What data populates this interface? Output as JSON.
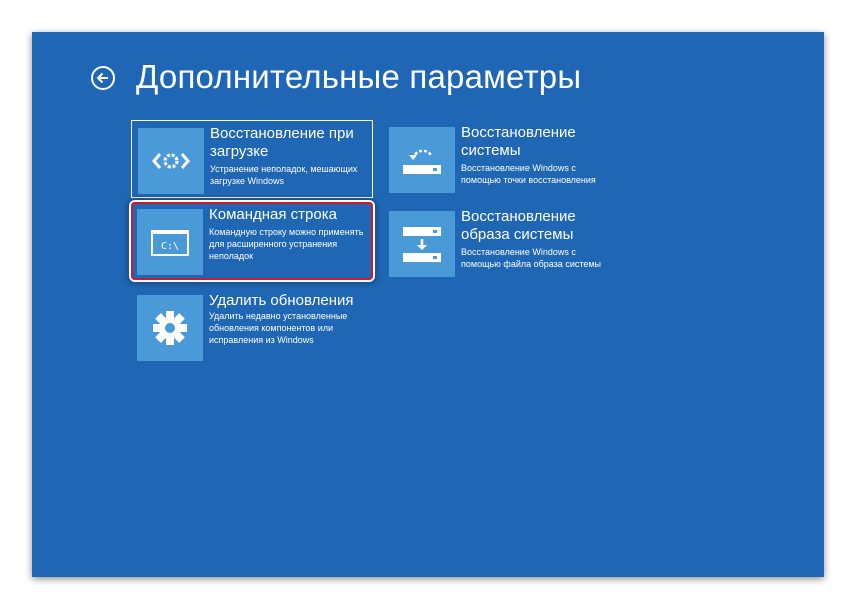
{
  "header": {
    "back_icon": "back-arrow-icon",
    "title": "Дополнительные параметры"
  },
  "options": [
    {
      "id": "startup-repair",
      "icon": "code-brackets-gear-icon",
      "title_lines": [
        "Восстановление при",
        "загрузке"
      ],
      "desc_lines": [
        "Устранение неполадок, мешающих",
        "загрузке Windows"
      ]
    },
    {
      "id": "system-restore",
      "icon": "restore-point-icon",
      "title_lines": [
        "Восстановление",
        "системы"
      ],
      "desc_lines": [
        "Восстановление Windows с",
        "помощью точки восстановления"
      ]
    },
    {
      "id": "command-prompt",
      "icon": "command-prompt-icon",
      "icon_text": "C:\\",
      "title_lines": [
        "Командная строка"
      ],
      "desc_lines": [
        "Командную строку можно применять",
        "для расширенного устранения",
        "неполадок"
      ]
    },
    {
      "id": "system-image-recovery",
      "icon": "system-image-icon",
      "title_lines": [
        "Восстановление",
        "образа системы"
      ],
      "desc_lines": [
        "Восстановление Windows с",
        "помощью файла образа системы"
      ]
    },
    {
      "id": "uninstall-updates",
      "icon": "gear-icon",
      "title_lines": [
        "Удалить обновления"
      ],
      "desc_lines": [
        "Удалить недавно установленные",
        "обновления компонентов или",
        "исправления из Windows"
      ]
    }
  ],
  "colors": {
    "background": "#1f66b4",
    "tile_icon": "#4a9ad8",
    "highlight_border": "#d31a2c"
  }
}
